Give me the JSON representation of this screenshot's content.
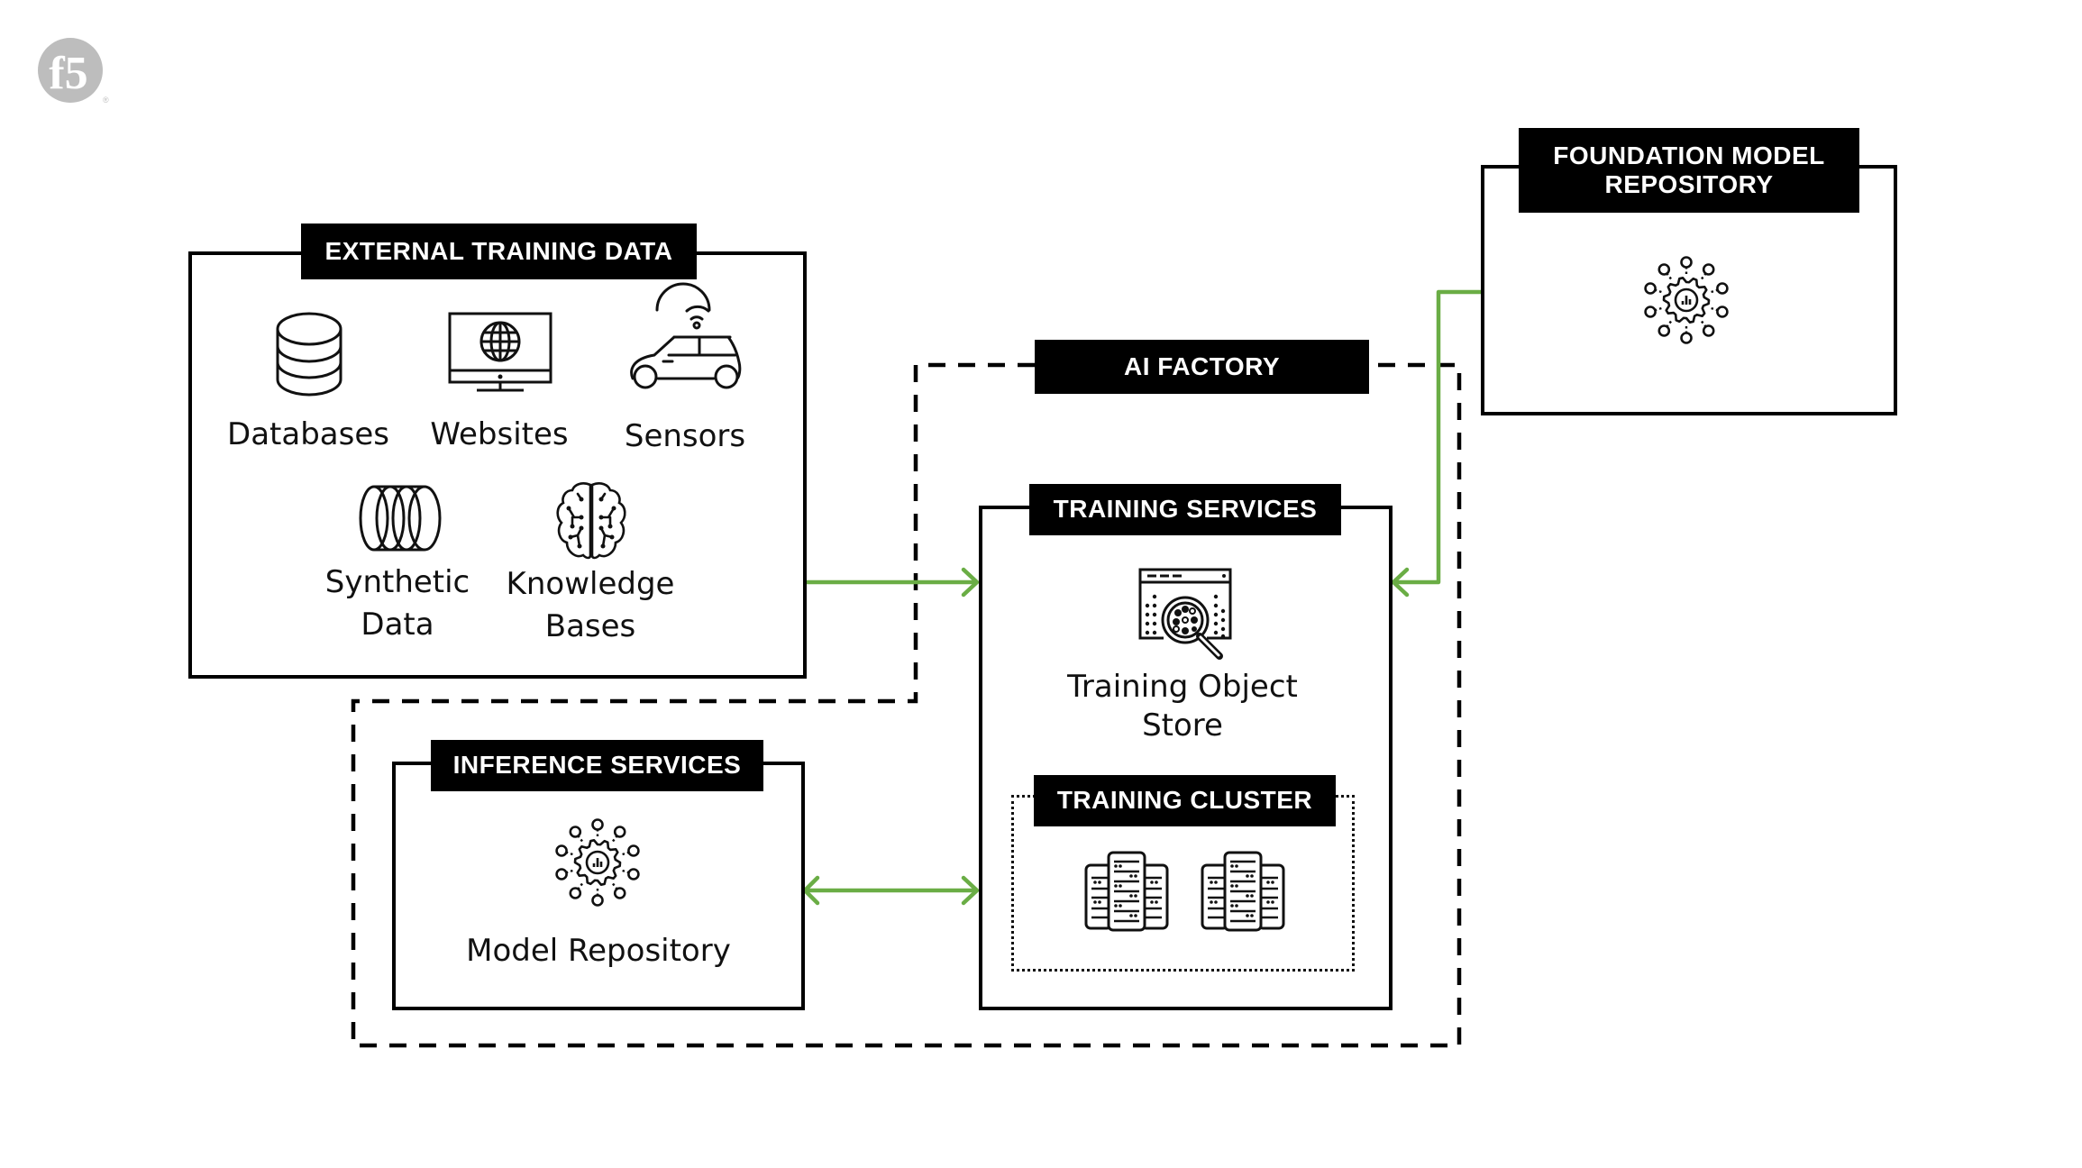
{
  "logo": {
    "text": "f5",
    "icon": "f5-logo",
    "color": "#bdbdbd"
  },
  "colors": {
    "accent_arrow": "#6aad45",
    "frame": "#000000",
    "label_bg": "#000000",
    "label_text": "#ffffff"
  },
  "external_training_data": {
    "title": "EXTERNAL TRAINING DATA",
    "items": [
      {
        "icon": "database-icon",
        "label_lines": [
          "Databases"
        ]
      },
      {
        "icon": "website-monitor-icon",
        "label_lines": [
          "Websites"
        ]
      },
      {
        "icon": "connected-car-icon",
        "label_lines": [
          "Sensors"
        ]
      },
      {
        "icon": "synthetic-data-icon",
        "label_lines": [
          "Synthetic",
          "Data"
        ]
      },
      {
        "icon": "brain-icon",
        "label_lines": [
          "Knowledge",
          "Bases"
        ]
      }
    ]
  },
  "ai_factory": {
    "title": "AI FACTORY"
  },
  "training_services": {
    "title": "TRAINING SERVICES",
    "object_store": {
      "icon": "object-store-search-icon",
      "label_lines": [
        "Training Object",
        "Store"
      ]
    },
    "cluster": {
      "title": "TRAINING CLUSTER",
      "servers": [
        "server-rack-icon",
        "server-rack-icon"
      ]
    }
  },
  "inference_services": {
    "title": "INFERENCE SERVICES",
    "model_repository": {
      "icon": "model-gear-network-icon",
      "label": "Model Repository"
    }
  },
  "foundation_model_repository": {
    "title_lines": [
      "FOUNDATION MODEL",
      "REPOSITORY"
    ],
    "icon": "model-gear-network-icon"
  },
  "connections": [
    {
      "from": "external_training_data",
      "to": "training_services",
      "direction": "one-way"
    },
    {
      "from": "foundation_model_repository",
      "to": "training_services",
      "direction": "one-way"
    },
    {
      "from": "inference_services",
      "to": "training_services",
      "direction": "two-way"
    }
  ]
}
